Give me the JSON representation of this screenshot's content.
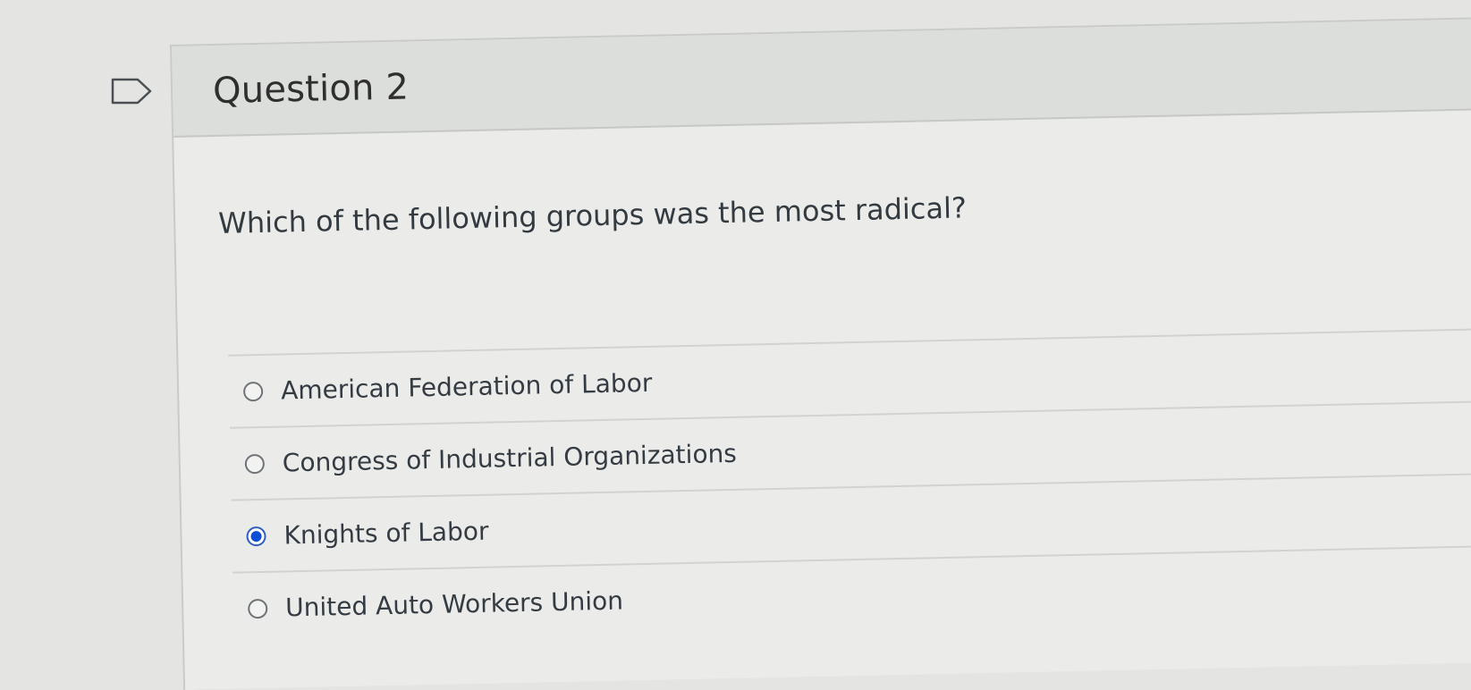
{
  "question": {
    "title": "Question 2",
    "text": "Which of the following groups was the most radical?",
    "flag_icon": "flag-outline-icon"
  },
  "answers": [
    {
      "label": "American Federation of Labor",
      "selected": false
    },
    {
      "label": "Congress of Industrial Organizations",
      "selected": false
    },
    {
      "label": "Knights of Labor",
      "selected": true
    },
    {
      "label": "United Auto Workers Union",
      "selected": false
    }
  ],
  "colors": {
    "selected_radio": "#0a4fd6",
    "background": "#e4e5e2",
    "header_background": "#dcdedb"
  }
}
